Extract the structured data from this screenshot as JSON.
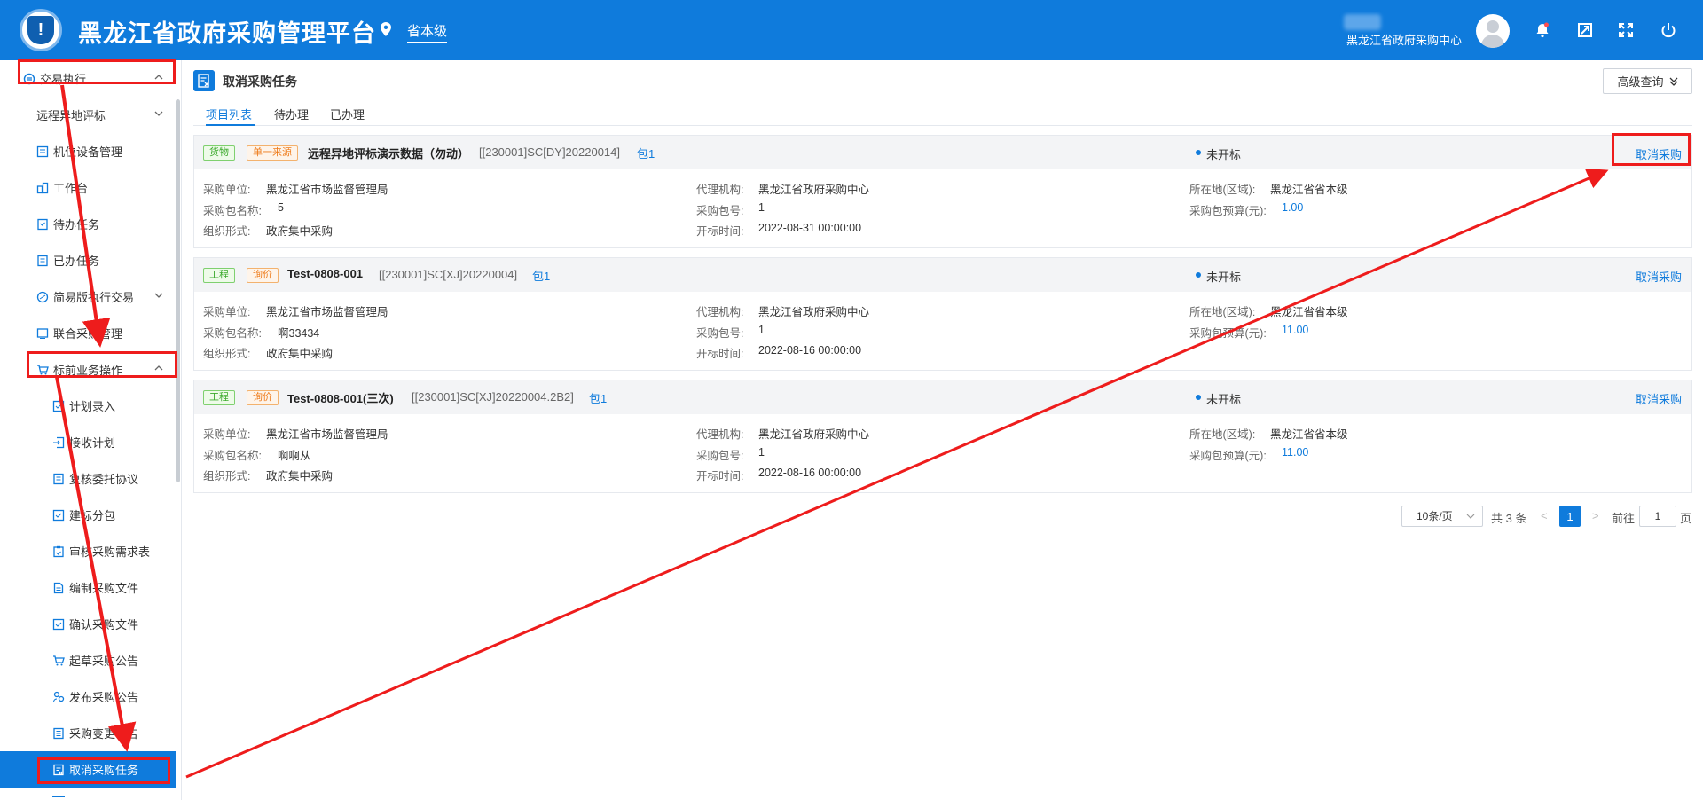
{
  "header": {
    "title": "黑龙江省政府采购管理平台",
    "location": "省本级",
    "user": "黑龙江省政府采购中心",
    "colors": {
      "primary": "#0f7bdc",
      "annotation_red": "#ee1c1c"
    },
    "icons": [
      "bell-icon",
      "screen-icon",
      "fullscreen-icon",
      "power-icon"
    ]
  },
  "sidebar": {
    "items": [
      {
        "label": "交易执行",
        "icon": "exchange-icon",
        "expanded": true
      },
      {
        "label": "远程异地评标",
        "icon": "",
        "expandable": true
      },
      {
        "label": "机位设备管理",
        "icon": "device-icon"
      },
      {
        "label": "工作台",
        "icon": "workbench-icon"
      },
      {
        "label": "待办任务",
        "icon": "todo-icon"
      },
      {
        "label": "已办任务",
        "icon": "done-icon"
      },
      {
        "label": "简易版执行交易",
        "icon": "simple-icon",
        "expandable": true
      },
      {
        "label": "联合采购管理",
        "icon": "joint-icon"
      },
      {
        "label": "标前业务操作",
        "icon": "cart-icon",
        "expanded": true
      },
      {
        "label": "计划录入",
        "icon": "plan-icon"
      },
      {
        "label": "接收计划",
        "icon": "receive-icon"
      },
      {
        "label": "复核委托协议",
        "icon": "review-icon"
      },
      {
        "label": "建标分包",
        "icon": "package-icon"
      },
      {
        "label": "审核采购需求表",
        "icon": "audit-icon"
      },
      {
        "label": "编制采购文件",
        "icon": "file-icon"
      },
      {
        "label": "确认采购文件",
        "icon": "confirm-icon"
      },
      {
        "label": "起草采购公告",
        "icon": "draft-icon"
      },
      {
        "label": "发布采购公告",
        "icon": "publish-icon"
      },
      {
        "label": "采购变更公告",
        "icon": "change-icon"
      },
      {
        "label": "取消采购任务",
        "icon": "cancel-task-icon",
        "active": true
      }
    ]
  },
  "main": {
    "title": "取消采购任务",
    "advanced_search": "高级查询",
    "tabs": [
      "项目列表",
      "待办理",
      "已办理"
    ],
    "active_tab": 0,
    "labels": {
      "unit": "采购单位:",
      "pkg_name": "采购包名称:",
      "org_form": "组织形式:",
      "agency": "代理机构:",
      "pkg_no": "采购包号:",
      "open_time": "开标时间:",
      "region": "所在地(区域):",
      "budget": "采购包预算(元):"
    },
    "cards": [
      {
        "tags": [
          "货物",
          "单一来源"
        ],
        "name": "远程异地评标演示数据（勿动）",
        "code": "[[230001]SC[DY]20220014]",
        "pkg": "包1",
        "status": "未开标",
        "action": "取消采购",
        "unit": "黑龙江省市场监督管理局",
        "pkg_name": "5",
        "org_form": "政府集中采购",
        "agency": "黑龙江省政府采购中心",
        "pkg_no": "1",
        "open_time": "2022-08-31 00:00:00",
        "region": "黑龙江省省本级",
        "budget": "1.00"
      },
      {
        "tags": [
          "工程",
          "询价"
        ],
        "name": "Test-0808-001",
        "code": "[[230001]SC[XJ]20220004]",
        "pkg": "包1",
        "status": "未开标",
        "action": "取消采购",
        "unit": "黑龙江省市场监督管理局",
        "pkg_name": "啊33434",
        "org_form": "政府集中采购",
        "agency": "黑龙江省政府采购中心",
        "pkg_no": "1",
        "open_time": "2022-08-16 00:00:00",
        "region": "黑龙江省省本级",
        "budget": "11.00"
      },
      {
        "tags": [
          "工程",
          "询价"
        ],
        "name": "Test-0808-001(三次)",
        "code": "[[230001]SC[XJ]20220004.2B2]",
        "pkg": "包1",
        "status": "未开标",
        "action": "取消采购",
        "unit": "黑龙江省市场监督管理局",
        "pkg_name": "啊啊从",
        "org_form": "政府集中采购",
        "agency": "黑龙江省政府采购中心",
        "pkg_no": "1",
        "open_time": "2022-08-16 00:00:00",
        "region": "黑龙江省省本级",
        "budget": "11.00"
      }
    ],
    "pagination": {
      "page_size": "10条/页",
      "total": "共 3 条",
      "prev": "<",
      "current": "1",
      "next": ">",
      "goto": "前往",
      "goto_value": "1",
      "unit": "页"
    }
  }
}
